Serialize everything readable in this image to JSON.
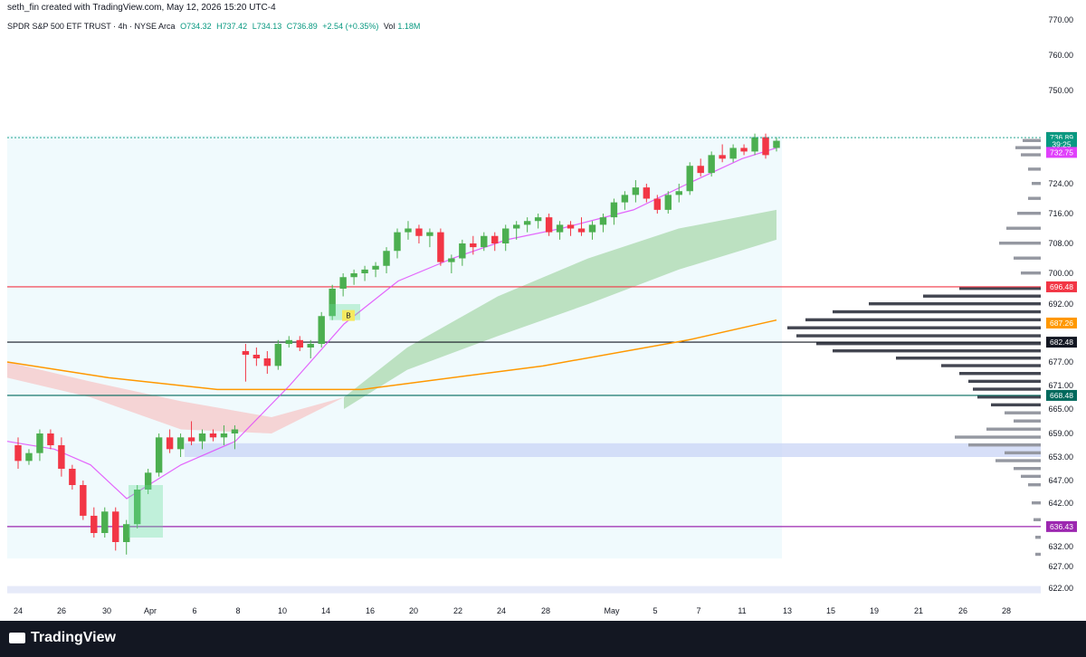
{
  "credit": "seth_fin created with TradingView.com, May 12, 2026 15:20 UTC-4",
  "legend": {
    "symbol": "SPDR S&P 500 ETF TRUST · 4h · NYSE Arca",
    "open": "O734.32",
    "high": "H737.42",
    "low": "L734.13",
    "close": "C736.89",
    "change": "+2.54 (+0.35%)",
    "volume_label": "Vol",
    "volume": "1.18M"
  },
  "brand": "TradingView",
  "chart_data": {
    "type": "candlestick",
    "timeframe": "4h",
    "y_axis_ticks": [
      770,
      760,
      750,
      724,
      716,
      708,
      700,
      692,
      677,
      671,
      665,
      659,
      653,
      647,
      642,
      632,
      627,
      622
    ],
    "y_axis_labels": [
      "770.00",
      "760.00",
      "750.00",
      "724.00",
      "716.00",
      "708.00",
      "700.00",
      "692.00",
      "677.00",
      "671.00",
      "665.00",
      "659.00",
      "653.00",
      "647.00",
      "642.00",
      "632.00",
      "627.00",
      "622.00"
    ],
    "x_axis_labels": [
      "24",
      "26",
      "30",
      "Apr",
      "6",
      "8",
      "10",
      "14",
      "16",
      "20",
      "22",
      "24",
      "28",
      "May",
      "5",
      "7",
      "11",
      "13",
      "15",
      "19",
      "21",
      "26",
      "28"
    ],
    "price_tags": [
      {
        "label": "736.92",
        "value": 736.92,
        "color": "#f23645"
      },
      {
        "label": "736.89",
        "value": 736.89,
        "color": "#089981"
      },
      {
        "label": "39:25",
        "value": 735.0,
        "color": "#089981"
      },
      {
        "label": "732.75",
        "value": 732.75,
        "color": "#e040fb"
      },
      {
        "label": "696.48",
        "value": 696.48,
        "color": "#f23645"
      },
      {
        "label": "687.26",
        "value": 687.26,
        "color": "#ff9800"
      },
      {
        "label": "682.48",
        "value": 682.48,
        "color": "#131722"
      },
      {
        "label": "668.48",
        "value": 668.48,
        "color": "#00695c"
      },
      {
        "label": "636.43",
        "value": 636.43,
        "color": "#9c27b0"
      }
    ],
    "horizontal_levels": [
      {
        "value": 696.48,
        "color": "#f23645"
      },
      {
        "value": 682.48,
        "color": "#131722"
      },
      {
        "value": 668.48,
        "color": "#00695c"
      },
      {
        "value": 636.43,
        "color": "#9c27b0"
      }
    ],
    "zones": [
      {
        "from": 653.0,
        "to": 656.5,
        "color": "#c9d4f5"
      },
      {
        "from": 620.5,
        "to": 622.5,
        "color": "#dde3f7"
      }
    ],
    "marker_label": "B",
    "candles": [
      [
        656,
        658,
        650,
        652
      ],
      [
        652,
        655,
        651,
        654
      ],
      [
        654,
        660,
        652,
        659
      ],
      [
        659,
        660,
        655,
        656
      ],
      [
        656,
        658,
        648,
        650
      ],
      [
        650,
        651,
        645,
        646
      ],
      [
        646,
        647,
        638,
        639
      ],
      [
        639,
        641,
        634,
        635
      ],
      [
        635,
        641,
        634,
        640
      ],
      [
        640,
        641,
        631,
        633
      ],
      [
        633,
        638,
        630,
        637
      ],
      [
        637,
        646,
        636,
        645
      ],
      [
        645,
        650,
        644,
        649
      ],
      [
        649,
        659,
        648,
        658
      ],
      [
        658,
        660,
        654,
        655
      ],
      [
        655,
        659,
        653,
        658
      ],
      [
        658,
        662,
        656,
        657
      ],
      [
        657,
        660,
        655,
        659
      ],
      [
        659,
        660,
        657,
        658
      ],
      [
        658,
        661,
        656,
        659
      ],
      [
        659,
        661,
        655,
        660
      ],
      [
        680,
        682,
        672,
        679
      ],
      [
        679,
        681,
        676,
        678
      ],
      [
        678,
        680,
        674,
        676
      ],
      [
        676,
        683,
        675,
        682
      ],
      [
        682,
        684,
        681,
        683
      ],
      [
        683,
        684,
        680,
        681
      ],
      [
        681,
        683,
        678,
        682
      ],
      [
        682,
        690,
        681,
        689
      ],
      [
        689,
        697,
        688,
        696
      ],
      [
        696,
        700,
        694,
        699
      ],
      [
        699,
        701,
        697,
        700
      ],
      [
        700,
        702,
        698,
        701
      ],
      [
        701,
        703,
        699,
        702
      ],
      [
        702,
        707,
        700,
        706
      ],
      [
        706,
        712,
        704,
        711
      ],
      [
        711,
        714,
        709,
        712
      ],
      [
        712,
        713,
        708,
        710
      ],
      [
        710,
        712,
        707,
        711
      ],
      [
        711,
        712,
        702,
        703
      ],
      [
        703,
        705,
        700,
        704
      ],
      [
        704,
        709,
        702,
        708
      ],
      [
        708,
        710,
        705,
        707
      ],
      [
        707,
        711,
        706,
        710
      ],
      [
        710,
        711,
        706,
        708
      ],
      [
        708,
        713,
        706,
        712
      ],
      [
        712,
        714,
        709,
        713
      ],
      [
        713,
        715,
        711,
        714
      ],
      [
        714,
        716,
        712,
        715
      ],
      [
        715,
        716,
        710,
        711
      ],
      [
        711,
        714,
        709,
        713
      ],
      [
        713,
        714,
        710,
        712
      ],
      [
        712,
        715,
        710,
        711
      ],
      [
        711,
        714,
        709,
        713
      ],
      [
        713,
        716,
        711,
        715
      ],
      [
        715,
        720,
        713,
        719
      ],
      [
        719,
        722,
        717,
        721
      ],
      [
        721,
        725,
        719,
        723
      ],
      [
        723,
        724,
        719,
        720
      ],
      [
        720,
        721,
        716,
        717
      ],
      [
        717,
        722,
        716,
        721
      ],
      [
        721,
        724,
        719,
        722
      ],
      [
        722,
        730,
        721,
        729
      ],
      [
        729,
        731,
        726,
        727
      ],
      [
        727,
        733,
        726,
        732
      ],
      [
        732,
        735,
        730,
        731
      ],
      [
        731,
        735,
        730,
        734
      ],
      [
        734,
        735,
        732,
        733
      ],
      [
        733,
        738,
        732,
        737
      ],
      [
        737,
        738,
        731,
        732
      ],
      [
        734,
        737,
        733,
        736
      ]
    ]
  }
}
